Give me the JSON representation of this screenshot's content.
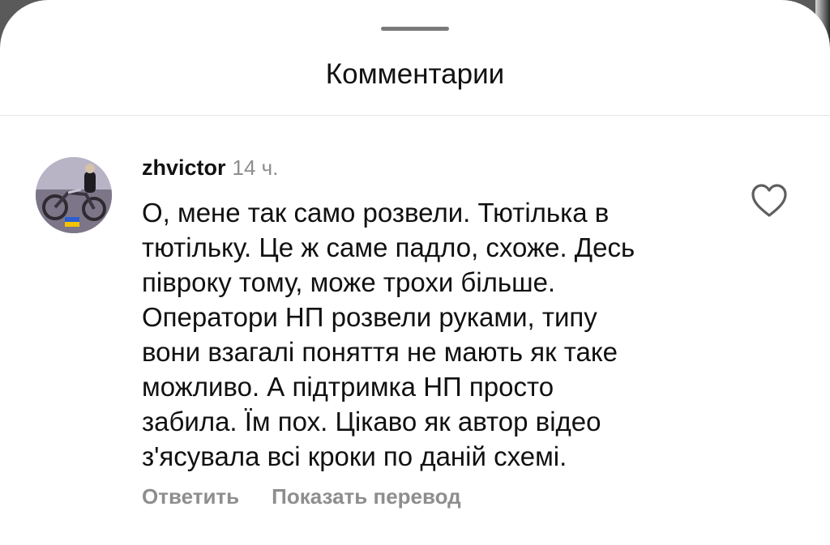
{
  "sheet": {
    "title": "Комментарии"
  },
  "comment": {
    "username": "zhvictor",
    "time": "14 ч.",
    "text": "О, мене так само розвели. Тютілька в\nтютільку. Це ж саме падло, схоже. Десь\nпівроку тому, може трохи більше.\nОператори НП розвели руками, типу\nвони взагалі поняття не мають як таке\nможливо.  А підтримка НП просто\nзабила. Їм пох. Цікаво як автор відео\nз'ясувала всі кроки по даній схемі.",
    "actions": {
      "reply": "Ответить",
      "translate": "Показать перевод"
    },
    "like_icon": "heart-outline-icon",
    "avatar": "avatar-photo-motorcycle"
  },
  "colors": {
    "text": "#111111",
    "secondary": "#8e8e8e",
    "background": "#ffffff"
  }
}
